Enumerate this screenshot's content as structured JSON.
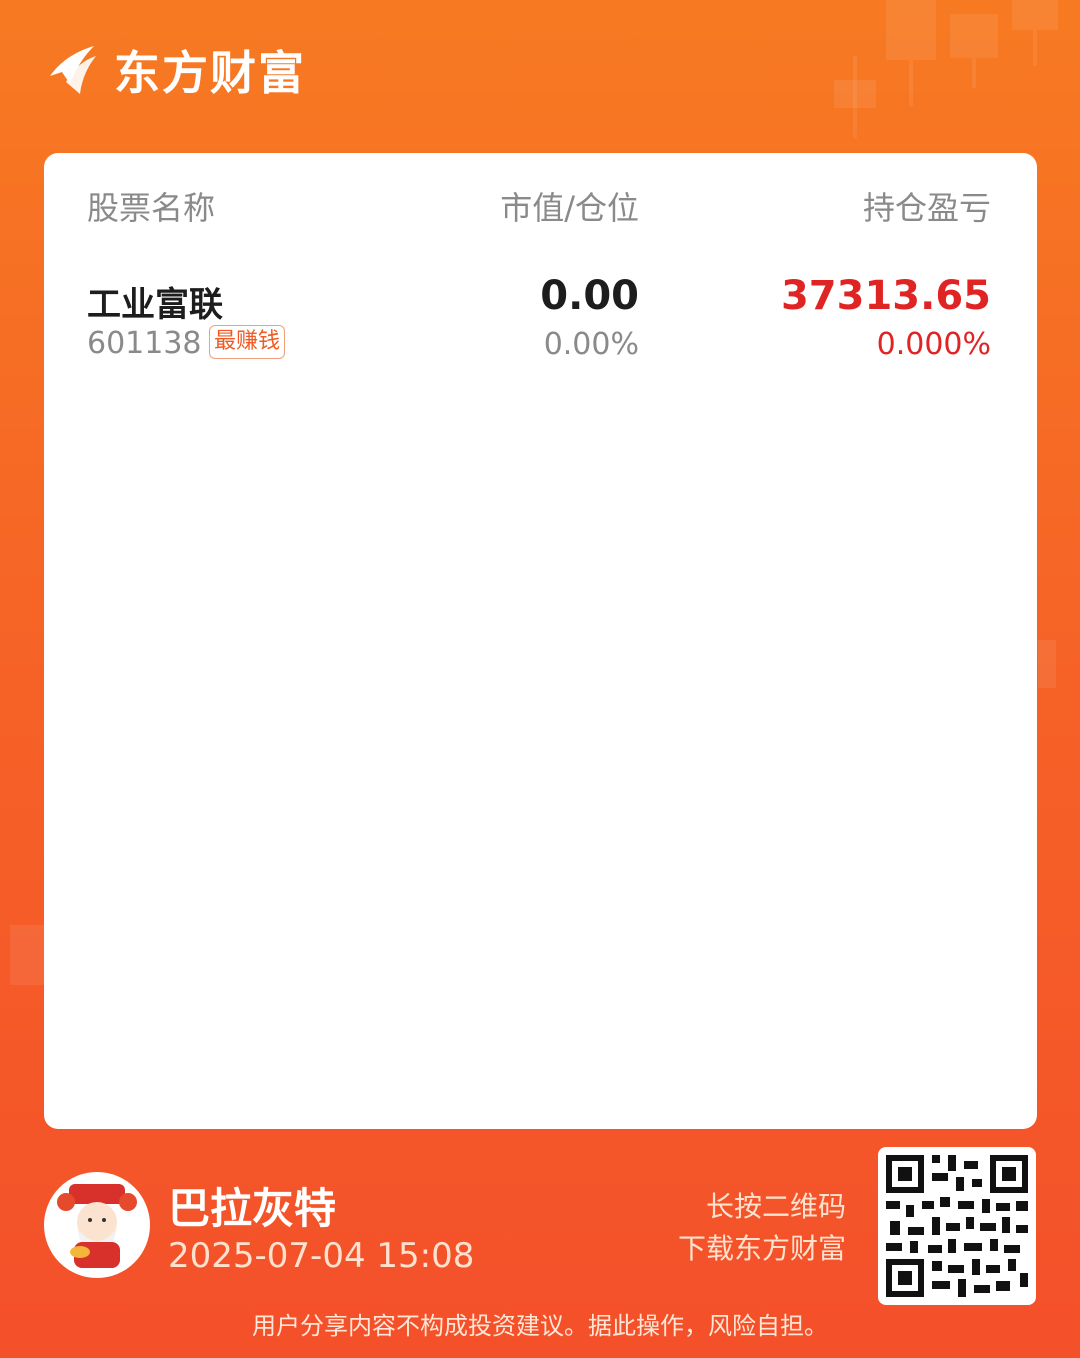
{
  "header": {
    "brand_name": "东方财富"
  },
  "table": {
    "columns": [
      "股票名称",
      "市值/仓位",
      "持仓盈亏"
    ],
    "rows": [
      {
        "name": "工业富联",
        "code": "601138",
        "badge": "最赚钱",
        "market_value": "0.00",
        "position_pct": "0.00%",
        "pnl": "37313.65",
        "pnl_pct": "0.000%"
      }
    ]
  },
  "footer": {
    "user_name": "巴拉灰特",
    "timestamp": "2025-07-04 15:08",
    "qr_hint_line1": "长按二维码",
    "qr_hint_line2": "下载东方财富",
    "disclaimer": "用户分享内容不构成投资建议。据此操作，风险自担。"
  },
  "colors": {
    "brand_orange": "#f66426",
    "profit_red": "#e02424",
    "muted_gray": "#8a8a8a"
  },
  "icons": {
    "logo": "eastmoney-logo-icon",
    "avatar": "fortune-god-avatar",
    "qr": "qr-code"
  }
}
